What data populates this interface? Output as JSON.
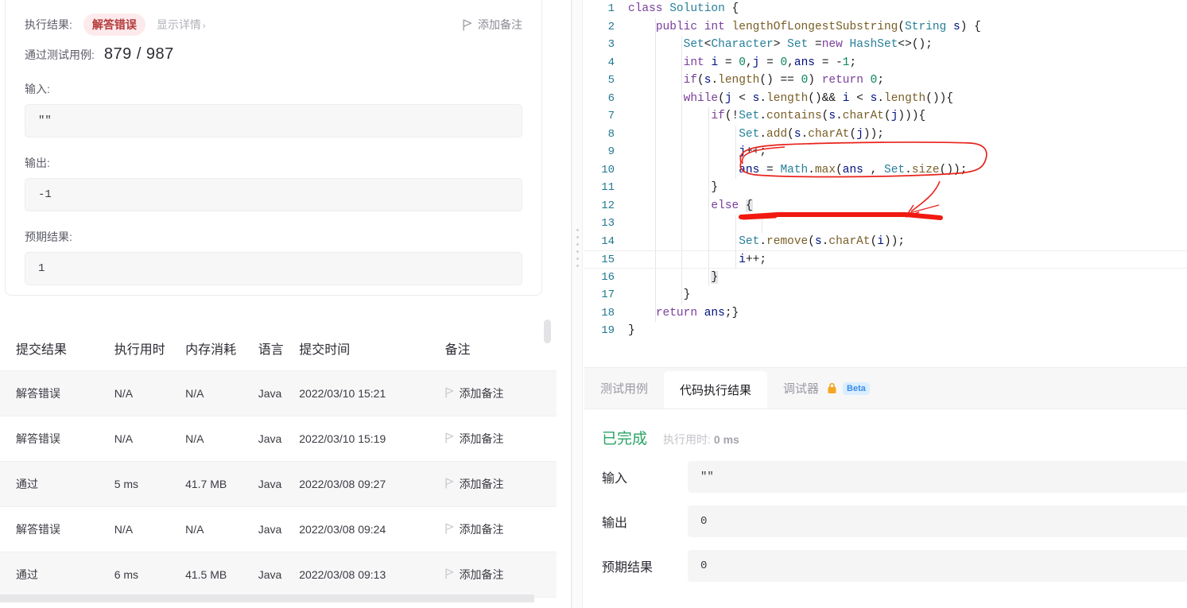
{
  "left": {
    "result_row": {
      "label": "执行结果:",
      "status": "解答错误",
      "status_color": "#b33a3a",
      "status_bg": "#fdeaec",
      "show_detail": "显示详情",
      "chevron": "›",
      "note_button": "添加备注",
      "note_icon": "flag-icon"
    },
    "pass_cases": {
      "label": "通过测试用例:",
      "value": "879 / 987"
    },
    "fields": [
      {
        "label": "输入:",
        "value": "\"\""
      },
      {
        "label": "输出:",
        "value": "-1"
      },
      {
        "label": "预期结果:",
        "value": "1"
      }
    ],
    "table": {
      "headers": [
        "提交结果",
        "执行用时",
        "内存消耗",
        "语言",
        "提交时间",
        "备注"
      ],
      "rows": [
        {
          "verdict": "解答错误",
          "verdict_type": "wa",
          "runtime": "N/A",
          "memory": "N/A",
          "lang": "Java",
          "time": "2022/03/10 15:21",
          "note": "添加备注"
        },
        {
          "verdict": "解答错误",
          "verdict_type": "wa",
          "runtime": "N/A",
          "memory": "N/A",
          "lang": "Java",
          "time": "2022/03/10 15:19",
          "note": "添加备注"
        },
        {
          "verdict": "通过",
          "verdict_type": "ac",
          "runtime": "5 ms",
          "memory": "41.7 MB",
          "lang": "Java",
          "time": "2022/03/08 09:27",
          "note": "添加备注"
        },
        {
          "verdict": "解答错误",
          "verdict_type": "wa",
          "runtime": "N/A",
          "memory": "N/A",
          "lang": "Java",
          "time": "2022/03/08 09:24",
          "note": "添加备注"
        },
        {
          "verdict": "通过",
          "verdict_type": "ac",
          "runtime": "6 ms",
          "memory": "41.5 MB",
          "lang": "Java",
          "time": "2022/03/08 09:13",
          "note": "添加备注"
        }
      ]
    },
    "colors": {
      "verdict_wa": "#e1534a",
      "verdict_ac": "#2aa465"
    }
  },
  "editor": {
    "language": "java",
    "current_line": 15,
    "lines": [
      {
        "n": "1",
        "text": "class Solution {"
      },
      {
        "n": "2",
        "text": "    public int lengthOfLongestSubstring(String s) {"
      },
      {
        "n": "3",
        "text": "        Set<Character> Set =new HashSet<>();"
      },
      {
        "n": "4",
        "text": "        int i = 0,j = 0,ans = -1;"
      },
      {
        "n": "5",
        "text": "        if(s.length() == 0) return 0;"
      },
      {
        "n": "6",
        "text": "        while(j < s.length()&& i < s.length()){"
      },
      {
        "n": "7",
        "text": "            if(!Set.contains(s.charAt(j))){"
      },
      {
        "n": "8",
        "text": "                Set.add(s.charAt(j));"
      },
      {
        "n": "9",
        "text": "                j++;"
      },
      {
        "n": "10",
        "text": "                ans = Math.max(ans , Set.size());"
      },
      {
        "n": "11",
        "text": "            }"
      },
      {
        "n": "12",
        "text": "            else {"
      },
      {
        "n": "13",
        "text": ""
      },
      {
        "n": "14",
        "text": "                Set.remove(s.charAt(i));"
      },
      {
        "n": "15",
        "text": "                i++;"
      },
      {
        "n": "16",
        "text": "            }"
      },
      {
        "n": "17",
        "text": "        }"
      },
      {
        "n": "18",
        "text": "    return ans;}"
      },
      {
        "n": "19",
        "text": "}"
      }
    ],
    "annotations": [
      {
        "type": "ellipse",
        "target_line": 10,
        "color": "#e8231c",
        "note": "hand-drawn circle around ans = Math.max(ans , Set.size());"
      },
      {
        "type": "underline",
        "target_line": 13,
        "color": "#f01a10",
        "note": "thick red horizontal stroke"
      },
      {
        "type": "arrow",
        "from_line": 11,
        "to_line": 13,
        "color": "#e8231c"
      }
    ]
  },
  "bottom": {
    "tabs": [
      {
        "label": "测试用例",
        "active": false
      },
      {
        "label": "代码执行结果",
        "active": true
      },
      {
        "label": "调试器",
        "active": false,
        "lock_icon": "lock-icon",
        "badge": "Beta"
      }
    ],
    "status": {
      "done": "已完成",
      "runtime_label": "执行用时:",
      "runtime_value": "0 ms"
    },
    "io": [
      {
        "label": "输入",
        "value": "\"\""
      },
      {
        "label": "输出",
        "value": "0"
      },
      {
        "label": "预期结果",
        "value": "0"
      }
    ]
  }
}
